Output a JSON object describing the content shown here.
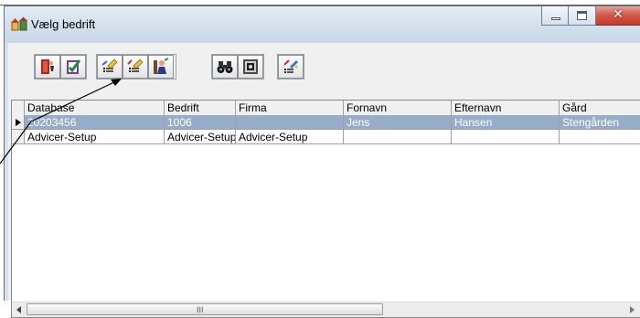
{
  "window": {
    "title": "Vælg bedrift",
    "caption": {
      "minimize_icon": "minimize-icon",
      "maximize_icon": "maximize-icon",
      "close_icon": "close-icon",
      "close_glyph": "✕"
    }
  },
  "toolbar": {
    "groups": [
      {
        "buttons": [
          {
            "icon": "exit-door-icon"
          },
          {
            "icon": "checklist-icon"
          }
        ]
      },
      {
        "buttons": [
          {
            "icon": "edit-list-icon"
          },
          {
            "icon": "edit-list-alt-icon"
          },
          {
            "icon": "person-setup-icon"
          }
        ]
      },
      {
        "buttons": [
          {
            "icon": "binoculars-icon"
          },
          {
            "icon": "safe-icon"
          }
        ]
      },
      {
        "buttons": [
          {
            "icon": "settings-wand-icon"
          }
        ]
      }
    ]
  },
  "grid": {
    "columns": [
      "Database",
      "Bedrift",
      "Firma",
      "Fornavn",
      "Efternavn",
      "Gård"
    ],
    "rows": [
      {
        "current": true,
        "cells": [
          "20203456",
          "1006",
          "",
          "Jens",
          "Hansen",
          "Stengården"
        ]
      },
      {
        "current": false,
        "cells": [
          "Advicer-Setup",
          "Advicer-Setup",
          "Advicer-Setup",
          "",
          "",
          ""
        ]
      }
    ],
    "scrollbar": {
      "grip": "III"
    }
  },
  "colors": {
    "selection": "#96acc9",
    "close_button": "#c7432f",
    "title_bar": "#d7e2ee"
  }
}
